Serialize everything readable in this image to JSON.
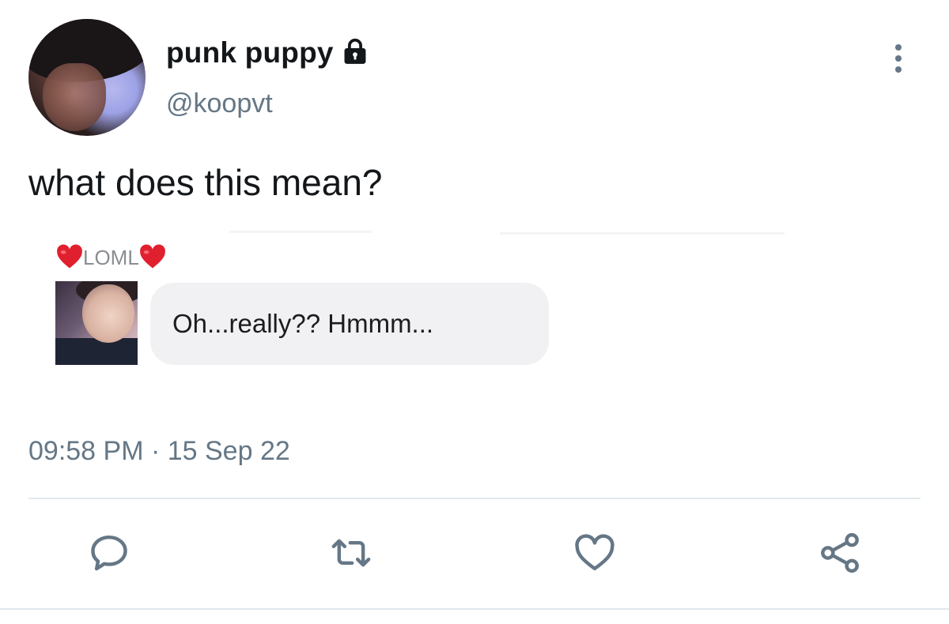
{
  "tweet": {
    "display_name": "punk puppy",
    "handle": "@koopvt",
    "text": "what does this mean?",
    "timestamp": "09:58 PM · 15 Sep 22"
  },
  "embedded_message": {
    "sender_name": "LOML",
    "message": "Oh...really?? Hmmm..."
  },
  "icons": {
    "lock": "lock-icon",
    "more": "vertical-ellipsis-icon",
    "heart_emoji": "red-heart-emoji",
    "reply": "speech-bubble-icon",
    "retweet": "retweet-icon",
    "like": "heart-outline-icon",
    "share": "share-nodes-icon"
  },
  "colors": {
    "text_primary": "#14171a",
    "text_secondary": "#657786",
    "icon": "#657786",
    "heart": "#e0202e",
    "bubble_bg": "#f1f1f3",
    "divider": "#e1e8ed"
  }
}
